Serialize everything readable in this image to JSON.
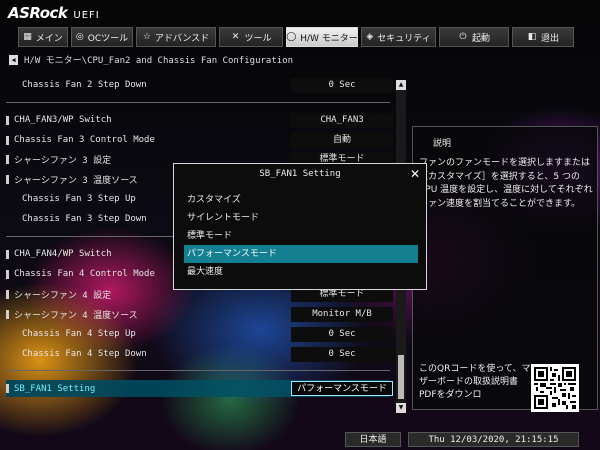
{
  "brand": {
    "name": "ASRock",
    "sub": "UEFI"
  },
  "tabs": [
    {
      "label": "メイン",
      "icon": "grid-icon",
      "glyph": "▦",
      "active": false
    },
    {
      "label": "OCツール",
      "icon": "gauge-icon",
      "glyph": "◎",
      "active": false
    },
    {
      "label": "アドバンスド",
      "icon": "star-icon",
      "glyph": "☆",
      "active": false
    },
    {
      "label": "ツール",
      "icon": "wrench-icon",
      "glyph": "✕",
      "active": false
    },
    {
      "label": "H/W モニター",
      "icon": "monitor-icon",
      "glyph": "◯",
      "active": true
    },
    {
      "label": "セキュリティ",
      "icon": "shield-icon",
      "glyph": "◈",
      "active": false
    },
    {
      "label": "起動",
      "icon": "power-icon",
      "glyph": "⏻",
      "active": false
    },
    {
      "label": "退出",
      "icon": "exit-icon",
      "glyph": "◧",
      "active": false
    }
  ],
  "breadcrumb": "H/W モニター\\CPU_Fan2 and Chassis Fan Configuration",
  "settings": [
    {
      "label": "Chassis Fan 2 Step Down",
      "value": "0 Sec",
      "indent": true
    },
    {
      "label": "CHA_FAN3/WP Switch",
      "value": "CHA_FAN3",
      "indent": false
    },
    {
      "label": "Chassis Fan 3 Control Mode",
      "value": "自動",
      "indent": false
    },
    {
      "label": "シャーシファン 3 設定",
      "value": "標準モード",
      "indent": false
    },
    {
      "label": "シャーシファン 3 温度ソース",
      "value": "Monitor M/B",
      "indent": false
    },
    {
      "label": "Chassis Fan 3 Step Up",
      "value": "0 Sec",
      "indent": true
    },
    {
      "label": "Chassis Fan 3 Step Down",
      "value": "0 Sec",
      "indent": true
    },
    {
      "label": "CHA_FAN4/WP Switch",
      "value": "CHA_FAN4",
      "indent": false
    },
    {
      "label": "Chassis Fan 4 Control Mode",
      "value": "自動",
      "indent": false
    },
    {
      "label": "シャーシファン 4 設定",
      "value": "標準モード",
      "indent": false
    },
    {
      "label": "シャーシファン 4 温度ソース",
      "value": "Monitor M/B",
      "indent": false
    },
    {
      "label": "Chassis Fan 4 Step Up",
      "value": "0 Sec",
      "indent": true
    },
    {
      "label": "Chassis Fan 4 Step Down",
      "value": "0 Sec",
      "indent": true
    },
    {
      "label": "SB_FAN1 Setting",
      "value": "パフォーマンスモード",
      "indent": false
    }
  ],
  "popup": {
    "title": "SB_FAN1 Setting",
    "options": [
      "カスタマイズ",
      "サイレントモード",
      "標準モード",
      "パフォーマンスモード",
      "最大速度"
    ],
    "selected": "パフォーマンスモード"
  },
  "help": {
    "title": "説明",
    "body": "ファンのファンモードを選択しますまたは［カスタマイズ］を選択すると、5 つの CPU 温度を設定し、温度に対してそれぞれファン速度を割当てることができます。",
    "qr_text": "このQRコードを使って、マザーボードの取扱説明書PDFをダウンロ"
  },
  "status": {
    "language": "日本語",
    "datetime": "Thu 12/03/2020, 21:15:15"
  },
  "colors": {
    "accent": "#137f91",
    "selected_text": "#6ef0ff"
  }
}
